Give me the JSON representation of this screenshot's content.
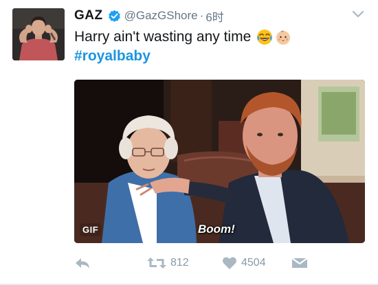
{
  "tweet": {
    "author_name": "GAZ",
    "handle": "@GazGShore",
    "separator": "·",
    "time": "6时",
    "verified": true,
    "text": "Harry ain't wasting any time",
    "emojis": [
      "face-with-tears-of-joy",
      "baby-face"
    ],
    "hashtag": "#royalbaby"
  },
  "media": {
    "badge": "GIF",
    "caption": "Boom!"
  },
  "actions": {
    "retweets": "812",
    "likes": "4504"
  },
  "icons": {
    "reply": "reply-icon",
    "retweet": "retweet-icon",
    "like": "heart-icon",
    "dm": "envelope-icon",
    "caret": "chevron-down-icon",
    "verified": "verified-badge-icon"
  },
  "colors": {
    "hashtag": "#1b95e0",
    "verified": "#1da1f2",
    "muted": "#657786",
    "action": "#aab8c2"
  }
}
